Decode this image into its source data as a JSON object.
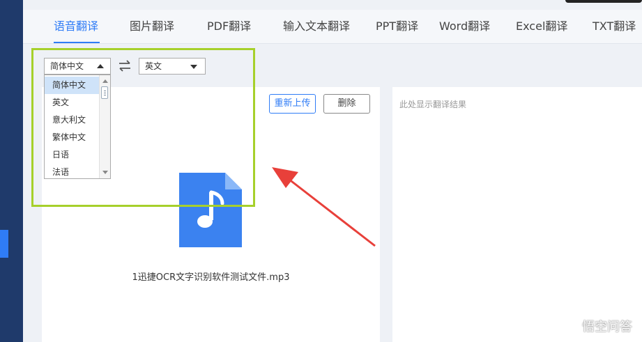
{
  "tabs": [
    "语音翻译",
    "图片翻译",
    "PDF翻译",
    "输入文本翻译",
    "PPT翻译",
    "Word翻译",
    "Excel翻译",
    "TXT翻译"
  ],
  "active_tab": "语音翻译",
  "source_lang": {
    "value": "简体中文"
  },
  "target_lang": {
    "value": "英文"
  },
  "swap_icon": "swap-arrows-icon",
  "dropdown": {
    "items": [
      "简体中文",
      "英文",
      "意大利文",
      "繁体中文",
      "日语",
      "法语"
    ],
    "selected": "简体中文"
  },
  "buttons": {
    "reupload": "重新上传",
    "delete": "删除"
  },
  "file": {
    "name": "1迅捷OCR文字识别软件测试文件.mp3",
    "icon": "music-file-icon"
  },
  "result": {
    "placeholder": "此处显示翻译结果"
  },
  "watermark": {
    "text": "悟空问答"
  },
  "colors": {
    "accent": "#2f7cf6",
    "highlight": "#a6d02b",
    "arrow": "#e8403a",
    "sidebar": "#1f3a6b"
  }
}
